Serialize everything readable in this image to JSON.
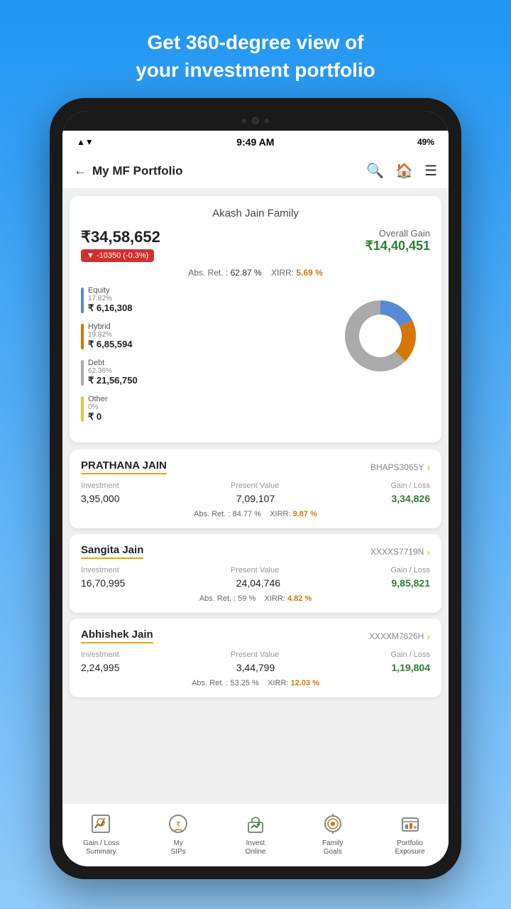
{
  "top_text": {
    "line1": "Get 360-degree view of",
    "line2": "your investment portfolio"
  },
  "status_bar": {
    "time": "9:49 AM",
    "battery": "49%"
  },
  "header": {
    "back_icon": "←",
    "title": "My MF Portfolio",
    "search_icon": "🔍",
    "home_icon": "🏠",
    "menu_icon": "☰"
  },
  "portfolio": {
    "family_name": "Akash Jain Family",
    "current_value": "₹34,58,652",
    "change_badge": "▼ -10350  (-0.3%)",
    "overall_gain_label": "Overall Gain",
    "overall_gain_value": "₹14,40,451",
    "abs_ret_label": "Abs. Ret. :",
    "abs_ret_value": "62.87 %",
    "xirr_label": "XIRR:",
    "xirr_value": "5.69 %",
    "breakdown": [
      {
        "label": "Equity",
        "pct": "17.82%",
        "amount": "₹ 6,16,308",
        "color": "#5b8ad4"
      },
      {
        "label": "Hybrid",
        "pct": "19.82%",
        "amount": "₹ 6,85,594",
        "color": "#d4760a"
      },
      {
        "label": "Debt",
        "pct": "62.36%",
        "amount": "₹ 21,56,750",
        "color": "#aaaaaa"
      },
      {
        "label": "Other",
        "pct": "0%",
        "amount": "₹ 0",
        "color": "#f0c040"
      }
    ],
    "donut": {
      "segments": [
        {
          "label": "Equity",
          "pct": 17.82,
          "color": "#5b8ad4"
        },
        {
          "label": "Hybrid",
          "pct": 19.82,
          "color": "#d4760a"
        },
        {
          "label": "Debt",
          "pct": 62.36,
          "color": "#aaaaaa"
        },
        {
          "label": "Other",
          "pct": 0,
          "color": "#f0c040"
        }
      ]
    }
  },
  "persons": [
    {
      "name": "PRATHANA JAIN",
      "id": "BHAPS3065Y",
      "investment": "3,95,000",
      "present_value": "7,09,107",
      "gain_loss": "3,34,826",
      "abs_ret": "84.77 %",
      "xirr": "9.87 %"
    },
    {
      "name": "Sangita Jain",
      "id": "XXXXS7719N",
      "investment": "16,70,995",
      "present_value": "24,04,746",
      "gain_loss": "9,85,821",
      "abs_ret": "59 %",
      "xirr": "4.82 %"
    },
    {
      "name": "Abhishek Jain",
      "id": "XXXXM7626H",
      "investment": "2,24,995",
      "present_value": "3,44,799",
      "gain_loss": "1,19,804",
      "abs_ret": "53.25 %",
      "xirr": "12.03 %"
    }
  ],
  "table_headers": {
    "investment": "Investment",
    "present_value": "Present Value",
    "gain_loss": "Gain / Loss"
  },
  "bottom_nav": [
    {
      "label": "Gain / Loss\nSummary",
      "icon": "gain-loss"
    },
    {
      "label": "My\nSIPs",
      "icon": "sips"
    },
    {
      "label": "Invest\nOnline",
      "icon": "invest"
    },
    {
      "label": "Family\nGoals",
      "icon": "goals"
    },
    {
      "label": "Portfolio\nExposure",
      "icon": "exposure"
    }
  ]
}
